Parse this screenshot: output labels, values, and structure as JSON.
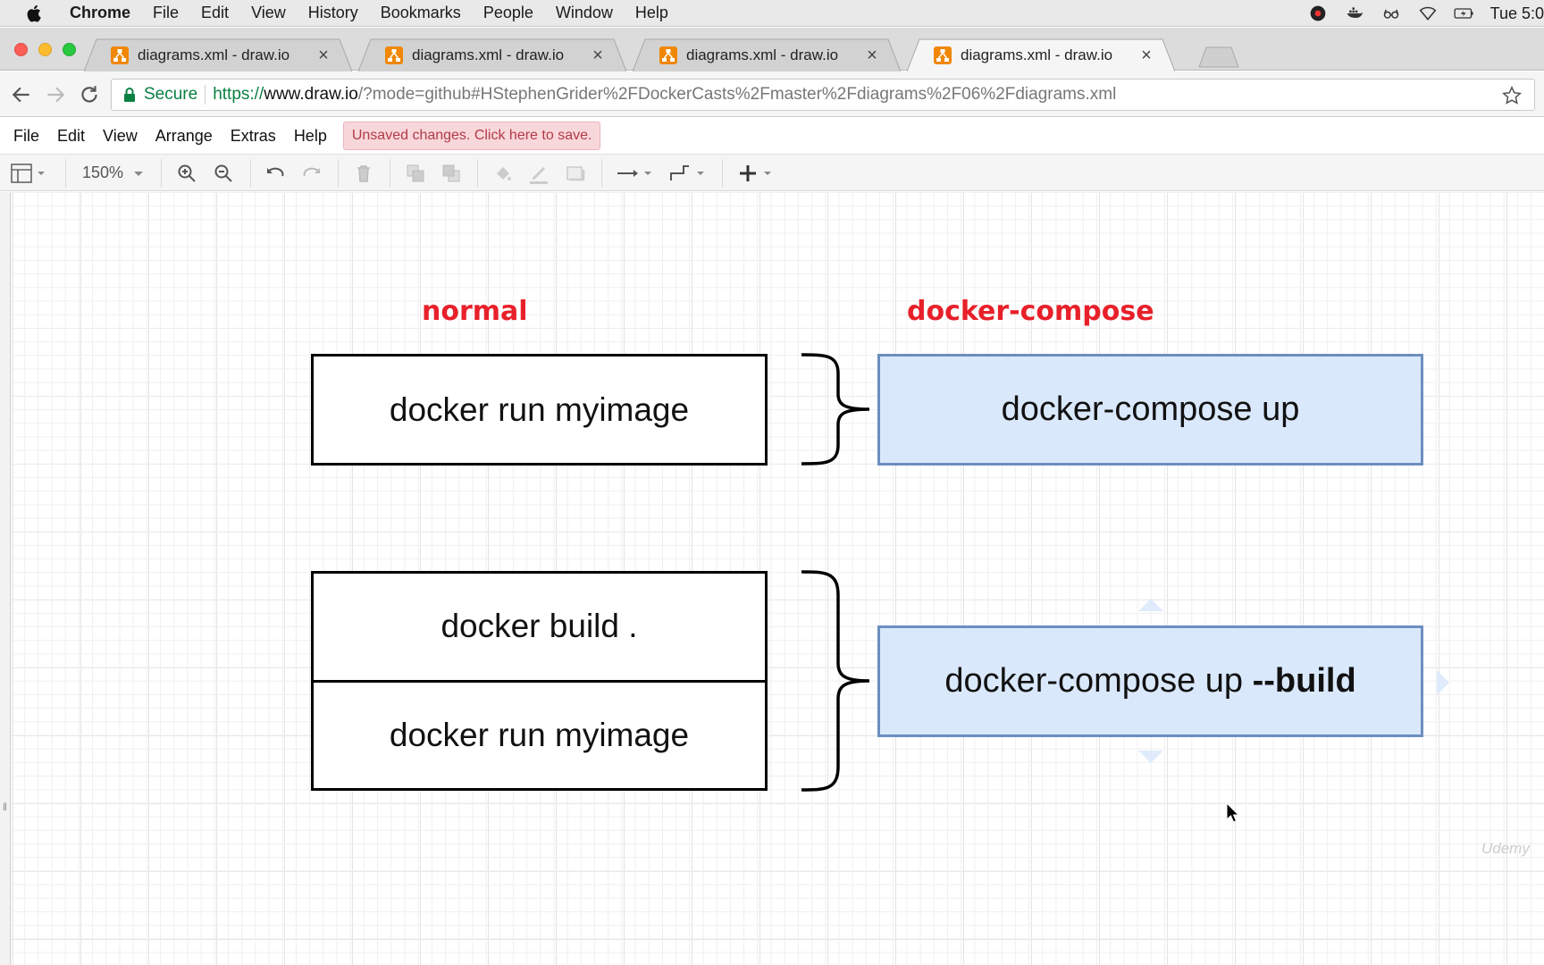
{
  "menubar": {
    "app": "Chrome",
    "items": [
      "File",
      "Edit",
      "View",
      "History",
      "Bookmarks",
      "People",
      "Window",
      "Help"
    ],
    "clock": "Tue 5:0",
    "status_icons": [
      "opera-icon",
      "docker-icon",
      "glasses-icon",
      "wifi-icon",
      "battery-icon"
    ]
  },
  "tabs": [
    {
      "title": "diagrams.xml - draw.io",
      "active": false
    },
    {
      "title": "diagrams.xml - draw.io",
      "active": false
    },
    {
      "title": "diagrams.xml - draw.io",
      "active": false
    },
    {
      "title": "diagrams.xml - draw.io",
      "active": true
    }
  ],
  "address": {
    "secure_label": "Secure",
    "scheme": "https://",
    "host": "www.draw.io",
    "path": "/?mode=github#HStephenGrider%2FDockerCasts%2Fmaster%2Fdiagrams%2F06%2Fdiagrams.xml"
  },
  "app_menu": {
    "items": [
      "File",
      "Edit",
      "View",
      "Arrange",
      "Extras",
      "Help"
    ],
    "unsaved": "Unsaved changes. Click here to save."
  },
  "toolbar": {
    "zoom": "150%"
  },
  "diagram": {
    "label_normal": "normal",
    "label_compose": "docker-compose",
    "box_run_top": "docker run myimage",
    "box_build": "docker build .",
    "box_run_bottom": "docker run myimage",
    "compose_up": "docker-compose up",
    "compose_up_build_prefix": "docker-compose up ",
    "compose_up_build_flag": "--build"
  },
  "watermark": "Udemy",
  "colors": {
    "label_red": "#e8202a",
    "blue_fill": "#dae8fc",
    "blue_stroke": "#6c8ebf",
    "unsaved_bg": "#f8d7da",
    "secure_green": "#0b8043",
    "drawio_orange": "#f08705"
  }
}
